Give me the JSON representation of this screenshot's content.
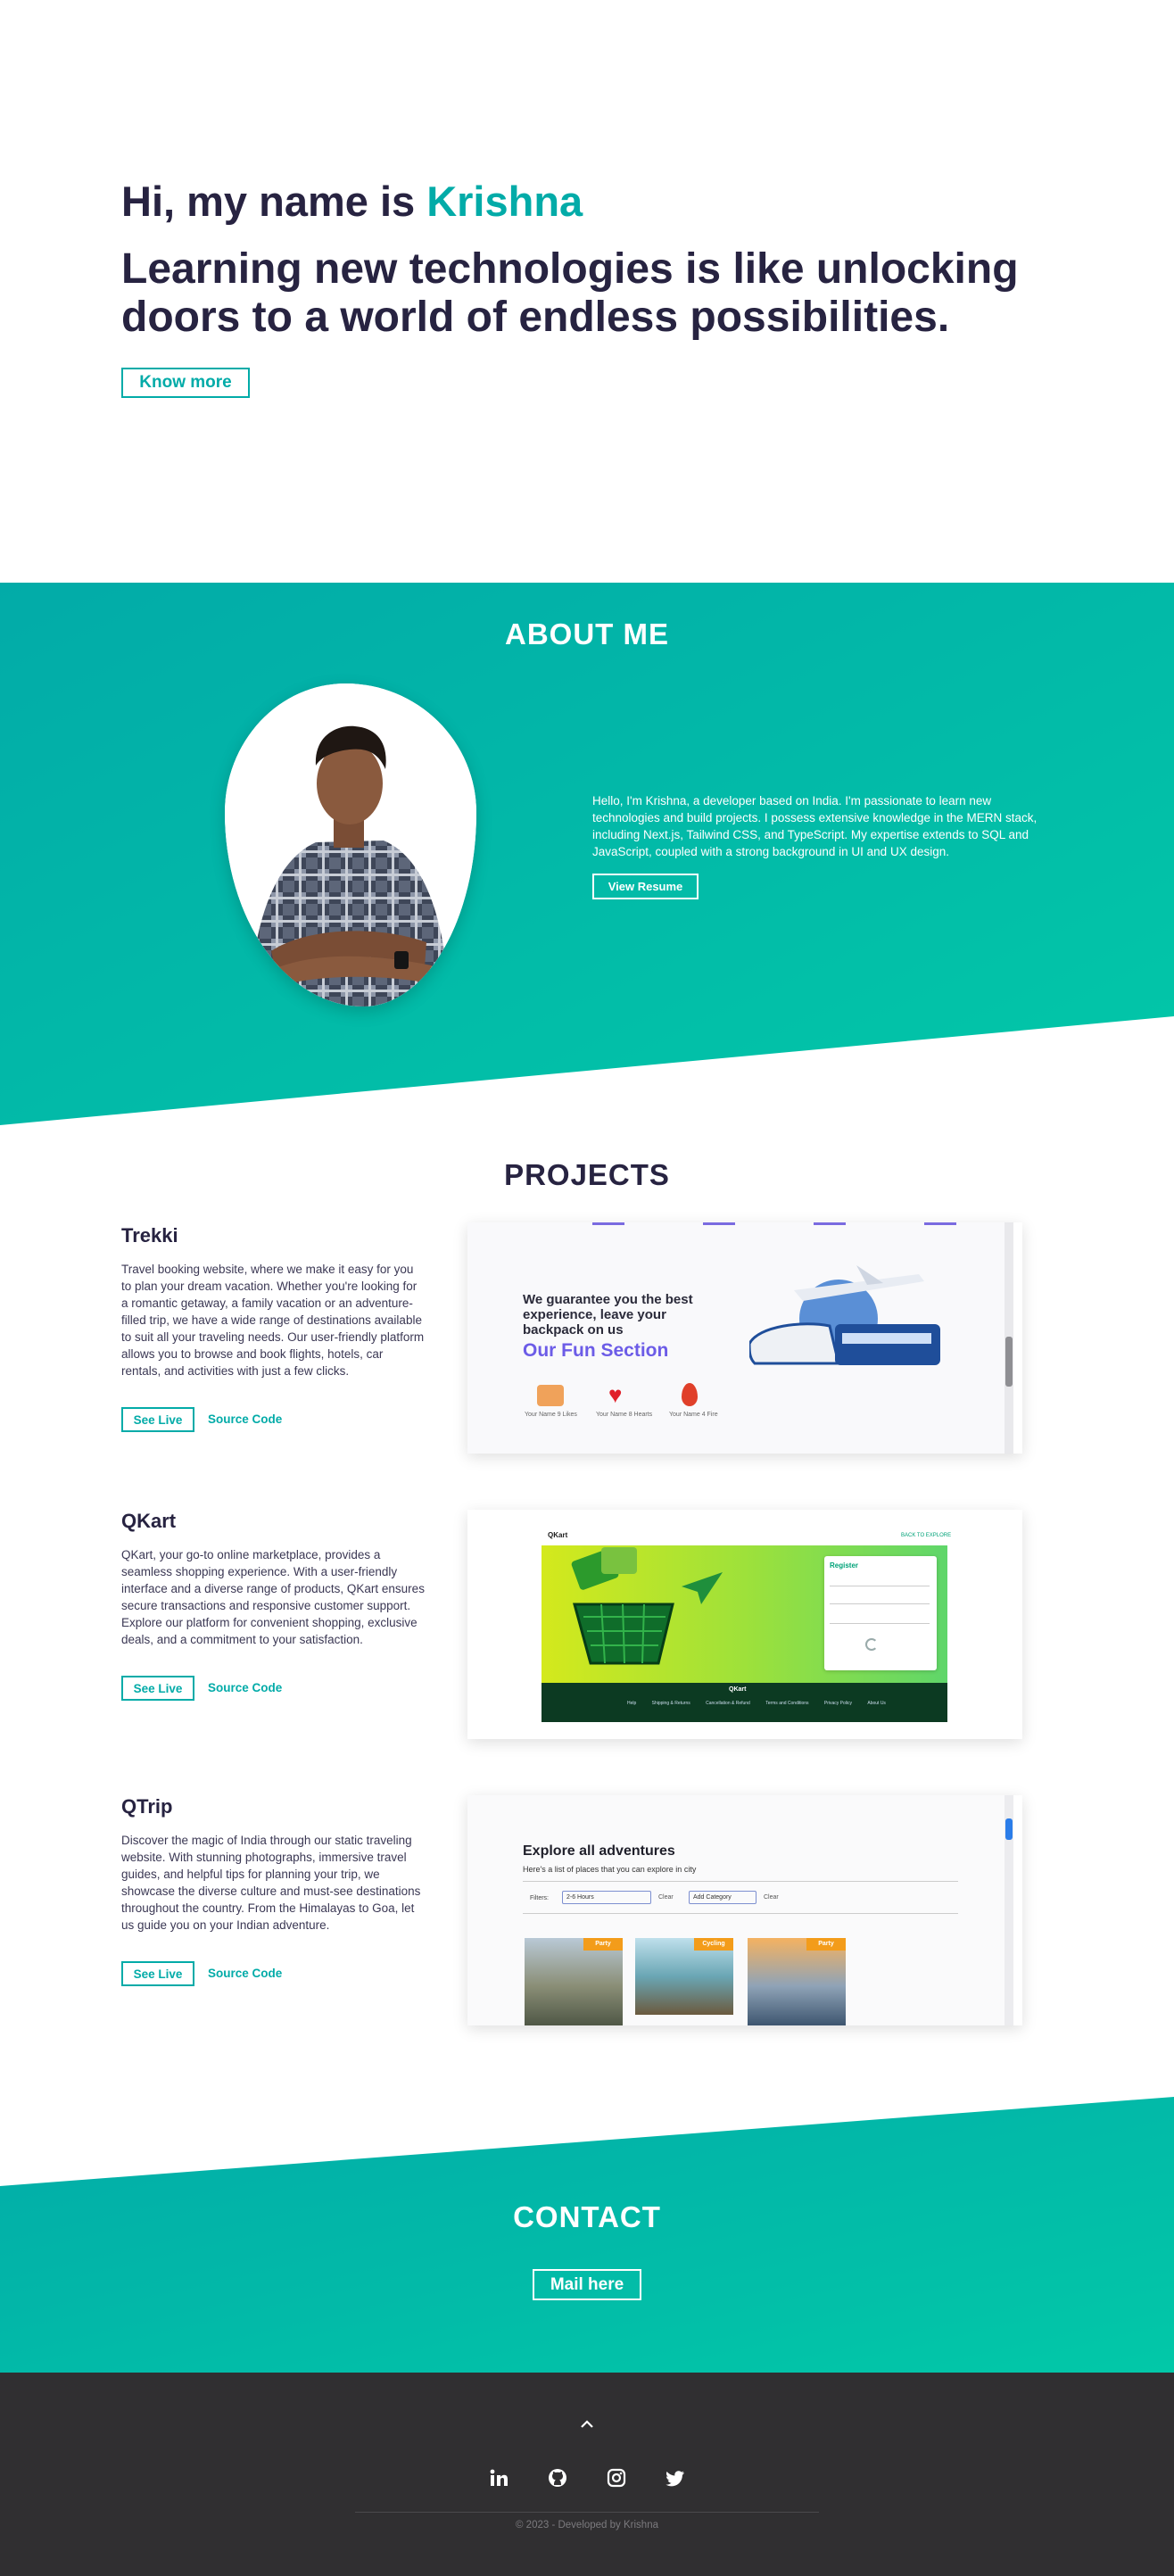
{
  "hero": {
    "greeting_prefix": "Hi, my name is ",
    "name": "Krishna",
    "tagline": "Learning new technologies is like unlocking doors to a world of endless possibilities.",
    "cta_label": "Know more"
  },
  "about": {
    "title": "ABOUT ME",
    "text": "Hello, I'm Krishna, a developer based on India. I'm passionate to learn new technologies and build projects. I possess extensive knowledge in the MERN stack, including Next.js, Tailwind CSS, and TypeScript. My expertise extends to SQL and JavaScript, coupled with a strong background in UI and UX design.",
    "resume_label": "View Resume"
  },
  "projects": {
    "title": "PROJECTS",
    "items": [
      {
        "name": "Trekki",
        "description": "Travel booking website, where we make it easy for you to plan your dream vacation. Whether you're looking for a romantic getaway, a family vacation or an adventure-filled trip, we have a wide range of destinations available to suit all your traveling needs. Our user-friendly platform allows you to browse and book flights, hotels, car rentals, and activities with just a few clicks.",
        "live_label": "See Live",
        "source_label": "Source Code",
        "preview": {
          "headline": "We guarantee you the best experience, leave your backpack on us",
          "fun": "Our Fun Section",
          "stats": [
            "Your Name 9 Likes",
            "Your Name 8 Hearts",
            "Your Name 4 Fire"
          ]
        }
      },
      {
        "name": "QKart",
        "description": "QKart, your go-to online marketplace, provides a seamless shopping experience. With a user-friendly interface and a diverse range of products, QKart ensures secure transactions and responsive customer support. Explore our platform for convenient shopping, exclusive deals, and a commitment to your satisfaction.",
        "live_label": "See Live",
        "source_label": "Source Code",
        "preview": {
          "logo": "QKart",
          "top_link": "BACK TO EXPLORE",
          "register": "Register",
          "footer_links": [
            "Help",
            "Shipping & Returns",
            "Cancellation & Refund",
            "Terms and Conditions",
            "Privacy Policy",
            "About Us"
          ]
        }
      },
      {
        "name": "QTrip",
        "description": "Discover the magic of India through our static traveling website. With stunning photographs, immersive travel guides, and helpful tips for planning your trip, we showcase the diverse culture and must-see destinations throughout the country. From the Himalayas to Goa, let us guide you on your Indian adventure.",
        "live_label": "See Live",
        "source_label": "Source Code",
        "preview": {
          "heading": "Explore all adventures",
          "subheading": "Here's a list of places that you can explore in city",
          "filters_label": "Filters:",
          "duration_value": "2-6 Hours",
          "category_value": "Add Category",
          "clear_label": "Clear",
          "cards": [
            "Party",
            "Cycling",
            "Party"
          ]
        }
      }
    ]
  },
  "contact": {
    "title": "CONTACT",
    "mail_label": "Mail here"
  },
  "footer": {
    "up_icon": "chevron-up-icon",
    "socials": [
      "linkedin-icon",
      "github-icon",
      "instagram-icon",
      "twitter-icon"
    ],
    "copyright": "© 2023 - Developed by Krishna"
  },
  "colors": {
    "accent": "#02aba8",
    "accent_light": "#02c8a8",
    "navy": "#272341",
    "footer": "#302f31"
  }
}
